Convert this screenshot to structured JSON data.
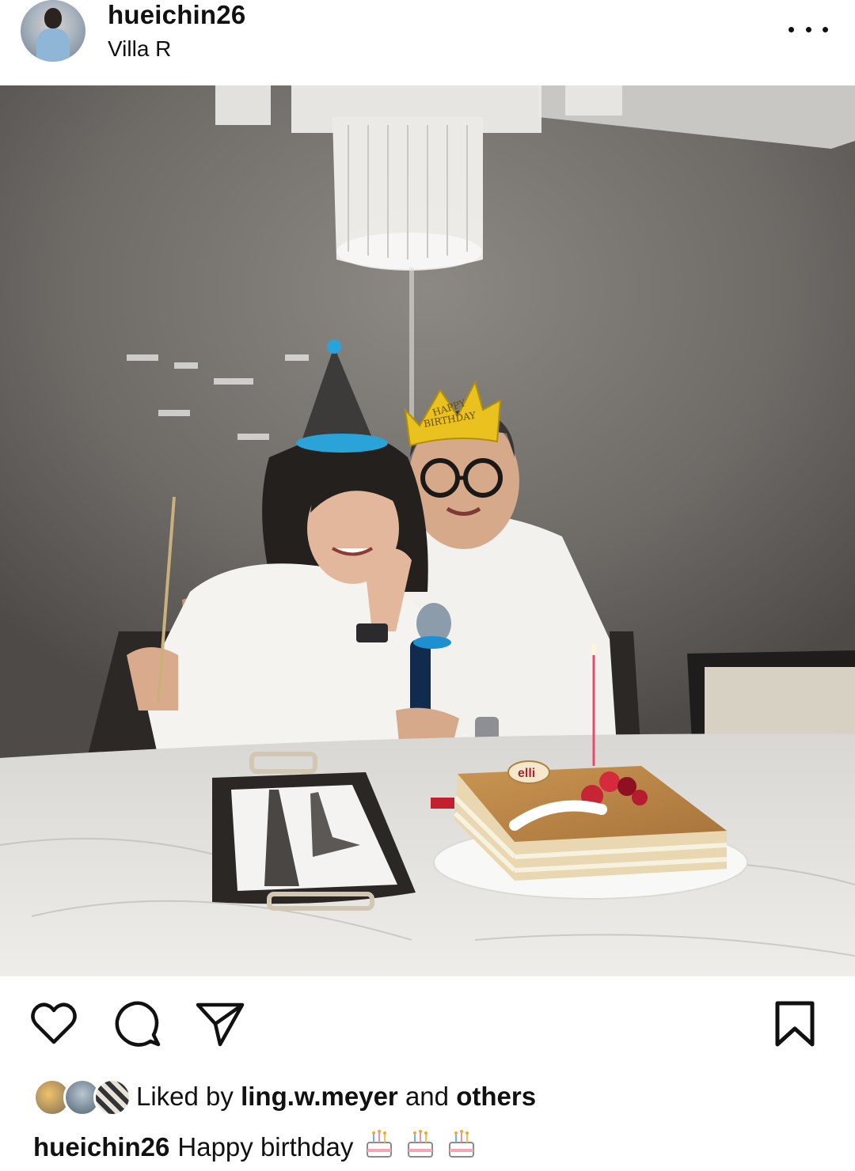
{
  "header": {
    "username": "hueichin26",
    "location": "Villa R",
    "avatar_icon": "profile-avatar",
    "more_icon": "more-horizontal-icon"
  },
  "photo": {
    "crown_text_1": "HAPPY",
    "crown_text_2": "BIRTHDAY",
    "cake_label": "elli"
  },
  "actions": {
    "like_icon": "heart-icon",
    "comment_icon": "comment-icon",
    "share_icon": "paper-plane-icon",
    "save_icon": "bookmark-icon"
  },
  "likes": {
    "prefix": "Liked by",
    "user": "ling.w.meyer",
    "middle": "and",
    "suffix": "others"
  },
  "caption": {
    "username": "hueichin26",
    "text": "Happy birthday",
    "emojis": [
      "cake-emoji",
      "cake-emoji",
      "cake-emoji"
    ]
  },
  "colors": {
    "wall": "#74716d",
    "table": "#e8e6e3",
    "hat_blue": "#2aa4d8",
    "crown_gold": "#e9c21f",
    "shirt": "#f3f2ef"
  }
}
